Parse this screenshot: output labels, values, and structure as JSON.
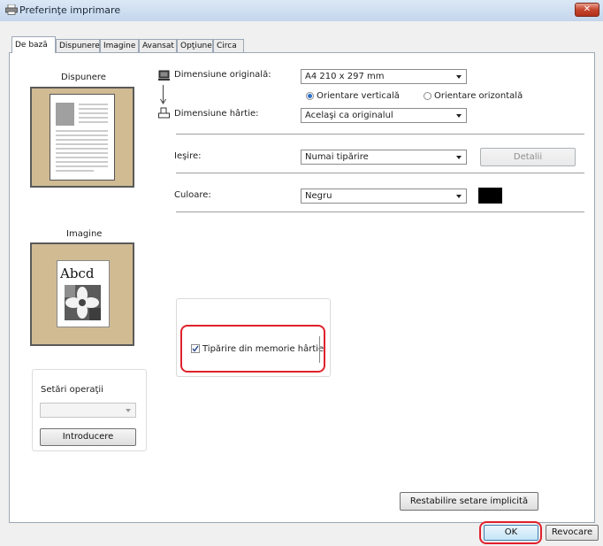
{
  "window": {
    "title": "Preferinţe imprimare",
    "close_symbol": "✕"
  },
  "tabs": [
    {
      "label": "De bază"
    },
    {
      "label": "Dispunere"
    },
    {
      "label": "Imagine"
    },
    {
      "label": "Avansat"
    },
    {
      "label": "Opţiune"
    },
    {
      "label": "Circa"
    }
  ],
  "left": {
    "layout_label": "Dispunere",
    "image_label": "Imagine",
    "sample_text": "Abcd",
    "ops": {
      "title": "Setări operaţii",
      "select_value": "",
      "button": "Introducere"
    }
  },
  "form": {
    "original_size": {
      "label": "Dimensiune originală:",
      "value": "A4 210 x 297 mm"
    },
    "orientation": {
      "portrait": "Orientare verticală",
      "landscape": "Orientare orizontală",
      "selected": "portrait"
    },
    "paper_size": {
      "label": "Dimensiune hârtie:",
      "value": "Acelaşi ca originalul"
    },
    "output": {
      "label": "Ieşire:",
      "value": "Numai tipărire",
      "details_button": "Detalii"
    },
    "color": {
      "label": "Culoare:",
      "value": "Negru",
      "swatch": "#000000"
    },
    "memory_checkbox": {
      "label": "Tipărire din memorie hârtie",
      "checked": true
    }
  },
  "footer": {
    "restore_button": "Restabilire setare implicită",
    "ok_button": "OK",
    "cancel_button": "Revocare"
  },
  "colors": {
    "preview_bg": "#d1bb93",
    "highlight": "#e0212b",
    "accent": "#2a6fc8"
  }
}
